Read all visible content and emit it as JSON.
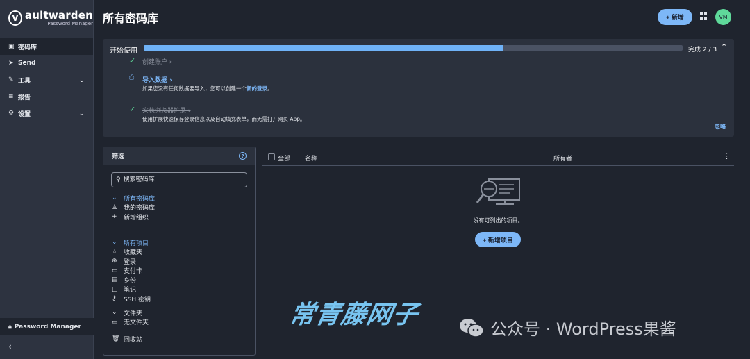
{
  "brand": {
    "logo_letter": "V",
    "name": "aultwarden",
    "sub": "Password Manager"
  },
  "sidebar": {
    "items": [
      {
        "icon": "▣",
        "label": "密码库",
        "active": true,
        "expandable": false
      },
      {
        "icon": "➤",
        "label": "Send",
        "active": false,
        "expandable": false
      },
      {
        "icon": "✎",
        "label": "工具",
        "active": false,
        "expandable": true
      },
      {
        "icon": "≡",
        "label": "报告",
        "active": false,
        "expandable": false
      },
      {
        "icon": "⚙",
        "label": "设置",
        "active": false,
        "expandable": true
      }
    ],
    "bottom_label": "Password Manager",
    "collapse_glyph": "‹"
  },
  "header": {
    "title": "所有密码库",
    "add_label": "+ 新增",
    "avatar_initials": "VM"
  },
  "getting_started": {
    "title": "开始使用",
    "progress": 0.667,
    "count_label": "完成 2 / 3",
    "collapse_glyph": "⌃",
    "steps": [
      {
        "icon": "✓",
        "title": "创建账户 ›",
        "done": true,
        "desc": "",
        "desc_link": "",
        "desc_end": ""
      },
      {
        "icon": "⎙",
        "title": "导入数据 ›",
        "done": false,
        "desc": "如果您没有任何数据要导入，您可以创建一个",
        "desc_link": "新的登录",
        "desc_end": "。"
      },
      {
        "icon": "✓",
        "title": "安装浏览器扩展 ›",
        "done": true,
        "desc": "使用扩展快速保存登录信息以及自动填充表单，而无需打开网页 App。",
        "desc_link": "",
        "desc_end": ""
      }
    ],
    "dismiss_label": "忽略"
  },
  "filter": {
    "title": "筛选",
    "search_placeholder": "搜索密码库",
    "vaults_group": [
      {
        "icon": "⌄",
        "label": "所有密码库",
        "head": true
      },
      {
        "icon": "♙",
        "label": "我的密码库",
        "head": false
      },
      {
        "icon": "+",
        "label": "新增组织",
        "head": false
      }
    ],
    "types_group": [
      {
        "icon": "⌄",
        "label": "所有项目",
        "head": true
      },
      {
        "icon": "☆",
        "label": "收藏夹",
        "head": false
      },
      {
        "icon": "⊕",
        "label": "登录",
        "head": false
      },
      {
        "icon": "▭",
        "label": "支付卡",
        "head": false
      },
      {
        "icon": "▤",
        "label": "身份",
        "head": false
      },
      {
        "icon": "◫",
        "label": "笔记",
        "head": false
      },
      {
        "icon": "⚷",
        "label": "SSH 密钥",
        "head": false
      }
    ],
    "folders_group": [
      {
        "icon": "⌄",
        "label": "文件夹",
        "head": false
      },
      {
        "icon": "▭",
        "label": "无文件夹",
        "head": false
      }
    ],
    "trash_label": "回收站",
    "trash_icon": "🗑"
  },
  "list": {
    "col_all": "全部",
    "col_name": "名称",
    "col_owner": "所有者",
    "more_glyph": "⋮",
    "empty_text": "没有可列出的项目。",
    "empty_button": "+ 新增项目"
  },
  "watermark": {
    "left": "常青藤网子",
    "right": "公众号 · WordPress果酱"
  },
  "colors": {
    "accent": "#7db7f7",
    "success": "#5fd99a",
    "bg": "#1f242e",
    "sidebar": "#2d3340"
  }
}
